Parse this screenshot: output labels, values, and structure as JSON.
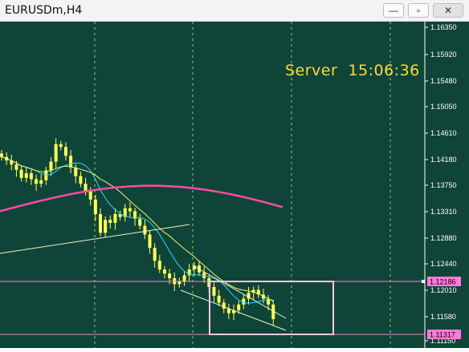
{
  "window": {
    "title": "EURUSDm,H4"
  },
  "controls": {
    "minimize": "—",
    "maximize": "▫",
    "close": "✕"
  },
  "server": {
    "label": "Server",
    "time": "15:06:36"
  },
  "price_axis": {
    "labels": [
      "1.16350",
      "1.15920",
      "1.15480",
      "1.15050",
      "1.14610",
      "1.14180",
      "1.13750",
      "1.13310",
      "1.12880",
      "1.12440",
      "1.12010",
      "1.11580",
      "1.11150"
    ],
    "tags": [
      {
        "value": "1.12186",
        "color": "#ff7ad9"
      },
      {
        "value": "1.11317",
        "color": "#ff7ad9"
      }
    ]
  },
  "colors": {
    "background": "#0f4538",
    "grid": "#c9e07a",
    "candles": "#ffff5a",
    "ma_long": "#ff4aa6",
    "ma_fast": "#27d9ff",
    "ma_mid": "#f3f36b",
    "trendline": "#f5efc6",
    "rectangle": "#ffc6e6",
    "hline": "#ff7ad9"
  },
  "chart_data": {
    "type": "candlestick",
    "symbol": "EURUSDm",
    "timeframe": "H4",
    "ylim": [
      1.11,
      1.165
    ],
    "closes": [
      1.1418,
      1.1412,
      1.1405,
      1.1396,
      1.1382,
      1.139,
      1.138,
      1.1372,
      1.1378,
      1.1395,
      1.141,
      1.144,
      1.1435,
      1.142,
      1.14,
      1.1385,
      1.1372,
      1.136,
      1.1345,
      1.132,
      1.1288,
      1.131,
      1.1305,
      1.132,
      1.1315,
      1.133,
      1.1325,
      1.1312,
      1.13,
      1.1285,
      1.1262,
      1.124,
      1.1225,
      1.1218,
      1.121,
      1.12,
      1.1205,
      1.1215,
      1.1225,
      1.1232,
      1.122,
      1.121,
      1.1195,
      1.118,
      1.1168,
      1.1158,
      1.115,
      1.1155,
      1.1165,
      1.1175,
      1.1185,
      1.119,
      1.1182,
      1.1175,
      1.1165,
      1.114
    ]
  }
}
